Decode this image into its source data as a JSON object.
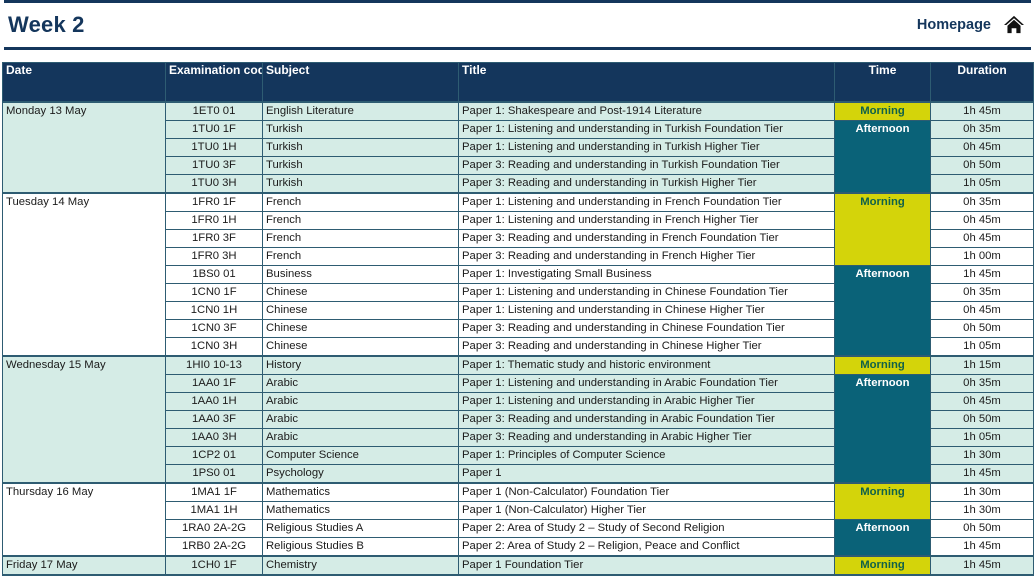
{
  "header": {
    "title": "Week 2",
    "homepage_label": "Homepage",
    "home_icon": "home-icon"
  },
  "colors": {
    "navy": "#14365c",
    "mint": "#d5ece6",
    "morning_bg": "#d4d40a",
    "morning_text": "#11614a",
    "afternoon_bg": "#0a6278",
    "afternoon_text": "#ffffff",
    "border": "#2e5c72"
  },
  "table": {
    "columns": [
      {
        "key": "date",
        "label": "Date"
      },
      {
        "key": "code",
        "label": "Examination code"
      },
      {
        "key": "subject",
        "label": "Subject"
      },
      {
        "key": "title",
        "label": "Title"
      },
      {
        "key": "time",
        "label": "Time"
      },
      {
        "key": "duration",
        "label": "Duration"
      }
    ],
    "days": [
      {
        "date": "Monday 13 May",
        "band": "mint",
        "rows": [
          {
            "code": "1ET0 01",
            "subject": "English Literature",
            "title": "Paper 1: Shakespeare and Post-1914 Literature",
            "session": "Morning",
            "session_start": true,
            "session_span": 1,
            "duration": "1h 45m"
          },
          {
            "code": "1TU0 1F",
            "subject": "Turkish",
            "title": "Paper 1: Listening and understanding in Turkish Foundation Tier",
            "session": "Afternoon",
            "session_start": true,
            "session_span": 4,
            "duration": "0h 35m"
          },
          {
            "code": "1TU0 1H",
            "subject": "Turkish",
            "title": "Paper 1: Listening and understanding in Turkish Higher Tier",
            "session": "Afternoon",
            "session_start": false,
            "duration": "0h 45m"
          },
          {
            "code": "1TU0 3F",
            "subject": "Turkish",
            "title": "Paper 3: Reading and understanding in Turkish Foundation Tier",
            "session": "Afternoon",
            "session_start": false,
            "duration": "0h 50m"
          },
          {
            "code": "1TU0 3H",
            "subject": "Turkish",
            "title": "Paper 3: Reading and understanding in Turkish Higher Tier",
            "session": "Afternoon",
            "session_start": false,
            "duration": "1h 05m"
          }
        ]
      },
      {
        "date": "Tuesday 14 May",
        "band": "plain",
        "rows": [
          {
            "code": "1FR0 1F",
            "subject": "French",
            "title": "Paper 1: Listening and understanding in French Foundation Tier",
            "session": "Morning",
            "session_start": true,
            "session_span": 4,
            "duration": "0h 35m"
          },
          {
            "code": "1FR0 1H",
            "subject": "French",
            "title": "Paper 1: Listening and understanding in French Higher Tier",
            "session": "Morning",
            "session_start": false,
            "duration": "0h 45m"
          },
          {
            "code": "1FR0 3F",
            "subject": "French",
            "title": "Paper 3: Reading and understanding in French Foundation Tier",
            "session": "Morning",
            "session_start": false,
            "duration": "0h 45m"
          },
          {
            "code": "1FR0 3H",
            "subject": "French",
            "title": "Paper 3: Reading and understanding in French Higher Tier",
            "session": "Morning",
            "session_start": false,
            "duration": "1h 00m"
          },
          {
            "code": "1BS0 01",
            "subject": "Business",
            "title": "Paper 1: Investigating Small Business",
            "session": "Afternoon",
            "session_start": true,
            "session_span": 5,
            "duration": "1h 45m"
          },
          {
            "code": "1CN0 1F",
            "subject": "Chinese",
            "title": "Paper 1: Listening and understanding in Chinese Foundation Tier",
            "session": "Afternoon",
            "session_start": false,
            "duration": "0h 35m"
          },
          {
            "code": "1CN0 1H",
            "subject": "Chinese",
            "title": "Paper 1: Listening and understanding in Chinese Higher Tier",
            "session": "Afternoon",
            "session_start": false,
            "duration": "0h 45m"
          },
          {
            "code": "1CN0 3F",
            "subject": "Chinese",
            "title": "Paper 3: Reading and understanding in Chinese Foundation Tier",
            "session": "Afternoon",
            "session_start": false,
            "duration": "0h 50m"
          },
          {
            "code": "1CN0 3H",
            "subject": "Chinese",
            "title": "Paper 3: Reading and understanding in Chinese Higher Tier",
            "session": "Afternoon",
            "session_start": false,
            "duration": "1h 05m"
          }
        ]
      },
      {
        "date": "Wednesday 15 May",
        "band": "mint",
        "rows": [
          {
            "code": "1HI0 10-13",
            "subject": "History",
            "title": "Paper 1: Thematic study and historic environment",
            "session": "Morning",
            "session_start": true,
            "session_span": 1,
            "duration": "1h 15m"
          },
          {
            "code": "1AA0 1F",
            "subject": "Arabic",
            "title": "Paper 1: Listening and understanding in Arabic Foundation Tier",
            "session": "Afternoon",
            "session_start": true,
            "session_span": 6,
            "duration": "0h 35m"
          },
          {
            "code": "1AA0 1H",
            "subject": "Arabic",
            "title": "Paper 1: Listening and understanding in Arabic Higher Tier",
            "session": "Afternoon",
            "session_start": false,
            "duration": "0h 45m"
          },
          {
            "code": "1AA0 3F",
            "subject": "Arabic",
            "title": "Paper 3: Reading and understanding in Arabic Foundation Tier",
            "session": "Afternoon",
            "session_start": false,
            "duration": "0h 50m"
          },
          {
            "code": "1AA0 3H",
            "subject": "Arabic",
            "title": "Paper 3: Reading and understanding in Arabic Higher Tier",
            "session": "Afternoon",
            "session_start": false,
            "duration": "1h 05m"
          },
          {
            "code": "1CP2 01",
            "subject": "Computer Science",
            "title": "Paper 1: Principles of Computer Science",
            "session": "Afternoon",
            "session_start": false,
            "duration": "1h 30m"
          },
          {
            "code": "1PS0 01",
            "subject": "Psychology",
            "title": "Paper 1",
            "session": "Afternoon",
            "session_start": false,
            "duration": "1h 45m"
          }
        ]
      },
      {
        "date": "Thursday 16 May",
        "band": "plain",
        "rows": [
          {
            "code": "1MA1 1F",
            "subject": "Mathematics",
            "title": "Paper 1 (Non-Calculator) Foundation Tier",
            "session": "Morning",
            "session_start": true,
            "session_span": 2,
            "duration": "1h 30m"
          },
          {
            "code": "1MA1 1H",
            "subject": "Mathematics",
            "title": "Paper 1 (Non-Calculator) Higher Tier",
            "session": "Morning",
            "session_start": false,
            "duration": "1h 30m"
          },
          {
            "code": "1RA0 2A-2G",
            "subject": "Religious Studies A",
            "title": "Paper 2: Area of Study 2 – Study of Second Religion",
            "session": "Afternoon",
            "session_start": true,
            "session_span": 2,
            "duration": "0h 50m"
          },
          {
            "code": "1RB0 2A-2G",
            "subject": "Religious Studies B",
            "title": "Paper 2: Area of Study 2 – Religion, Peace and Conflict",
            "session": "Afternoon",
            "session_start": false,
            "duration": "1h 45m"
          }
        ]
      },
      {
        "date": "Friday 17 May",
        "band": "mint",
        "rows": [
          {
            "code": "1CH0 1F",
            "subject": "Chemistry",
            "title": "Paper 1 Foundation Tier",
            "session": "Morning",
            "session_start": true,
            "session_span": 1,
            "duration": "1h 45m"
          }
        ]
      }
    ]
  }
}
